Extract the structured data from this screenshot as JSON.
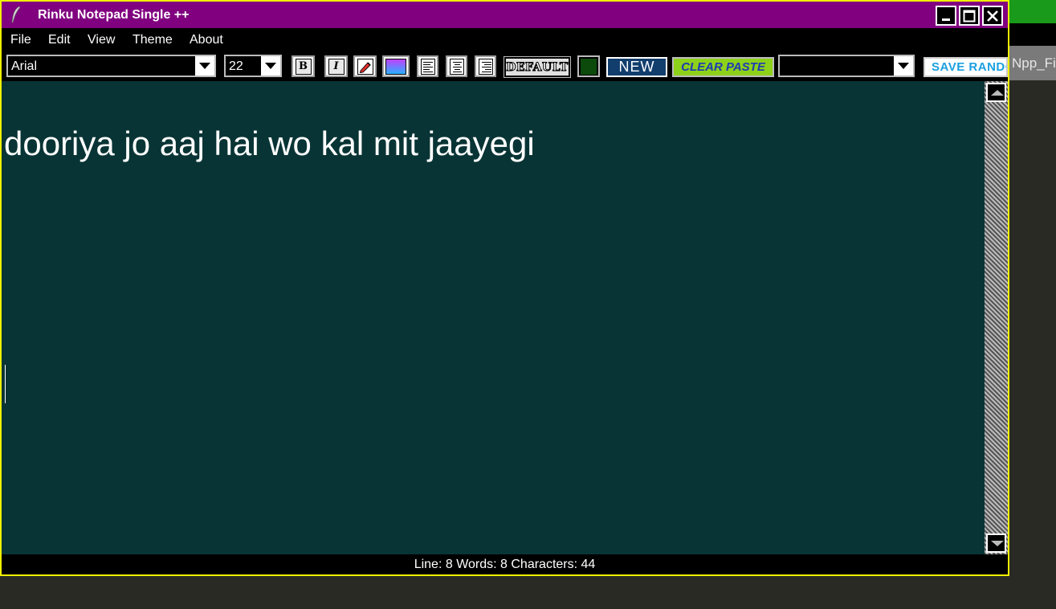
{
  "window": {
    "title": "Rinku Notepad Single ++",
    "frame_color": "#f0f000",
    "titlebar_color": "#800080",
    "controls": {
      "minimize_icon": "minimize-icon",
      "maximize_icon": "maximize-icon",
      "close_icon": "close-icon"
    }
  },
  "menubar": {
    "items": [
      {
        "label": "File"
      },
      {
        "label": "Edit"
      },
      {
        "label": "View"
      },
      {
        "label": "Theme"
      },
      {
        "label": "About"
      }
    ]
  },
  "toolbar": {
    "font_family": "Arial",
    "font_size": "22",
    "bold_label": "B",
    "italic_label": "I",
    "default_label": "DEFAULT",
    "new_label": "NEW",
    "clear_paste_label": "CLEAR PASTE",
    "extra_select_value": "",
    "save_random_label": "SAVE RANDOM",
    "color_swatch": "#0b4a0b",
    "gradient_swatch": [
      "#c040ff",
      "#2ab0ff"
    ]
  },
  "editor": {
    "background": "#093435",
    "text": "dooriya jo aaj hai wo kal mit jaayegi"
  },
  "status": {
    "text": "Line: 8 Words: 8 Characters: 44"
  },
  "desktop": {
    "taskbar_label": "Npp_Find"
  }
}
